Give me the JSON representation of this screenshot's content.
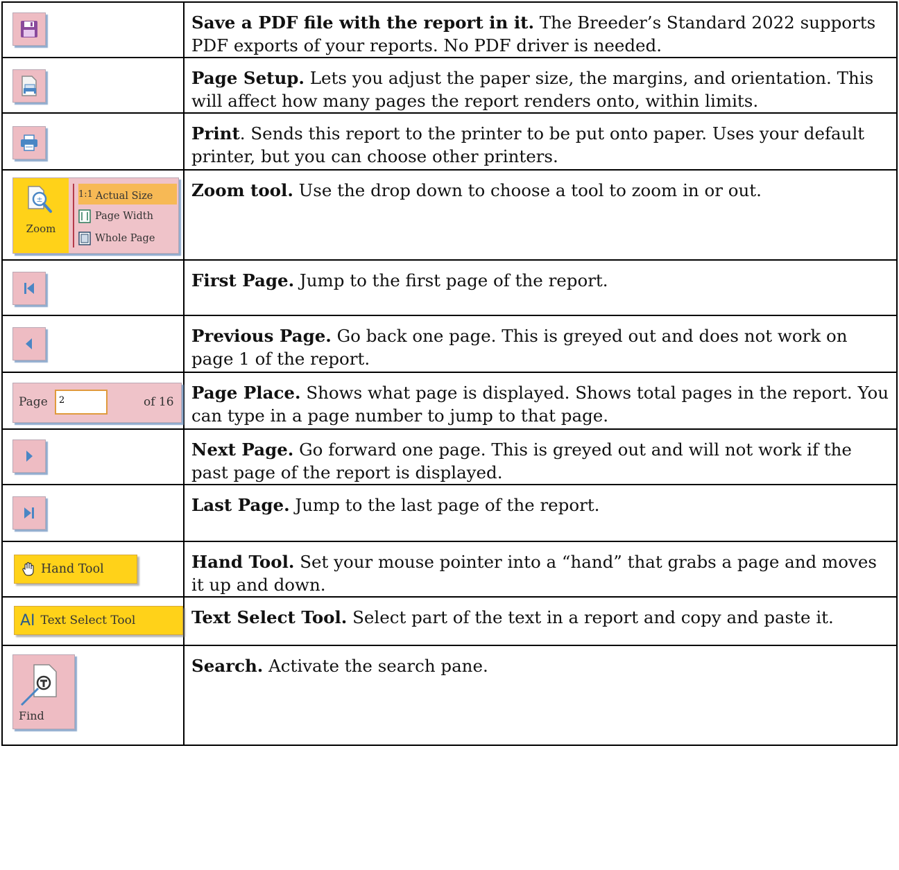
{
  "rows": [
    {
      "title": "Save a PDF file with the report in it.",
      "text": "  The Breeder’s Standard 2022 supports PDF exports of your reports.  No PDF driver is needed.",
      "icon": "save-icon"
    },
    {
      "title": "Page Setup.",
      "text": "  Lets you adjust the paper size, the margins, and orientation.  This will affect how many pages the report renders onto, within limits.",
      "icon": "page-setup-icon"
    },
    {
      "title": "Print",
      "text": ". Sends this report to the printer to be put onto paper.  Uses your default printer, but you can choose other printers.",
      "icon": "print-icon"
    },
    {
      "title": "Zoom tool.",
      "text": "  Use the drop down to choose a tool to zoom in or out.",
      "icon": "zoom-icon"
    },
    {
      "title": "First Page.",
      "text": "  Jump to the first page of the report.",
      "icon": "first-page-icon"
    },
    {
      "title": "Previous Page.",
      "text": "  Go back one page.  This is greyed out and does not work on page 1 of the report.",
      "icon": "previous-page-icon"
    },
    {
      "title": "Page Place.",
      "text": "  Shows what page is displayed.  Shows total pages in the report.  You can type in a page number to jump to that page.",
      "icon": "page-place"
    },
    {
      "title": "Next Page.",
      "text": "  Go forward one page.  This is greyed out and will not work if the past page of the report is displayed.",
      "icon": "next-page-icon"
    },
    {
      "title": "Last Page.",
      "text": "  Jump to the last page of the report.",
      "icon": "last-page-icon"
    },
    {
      "title": "Hand Tool.",
      "text": "  Set your mouse pointer into a “hand” that grabs a page and moves it up and down.",
      "icon": "hand-icon"
    },
    {
      "title": "Text Select Tool.",
      "text": "  Select part of the text in a report and copy and paste it.",
      "icon": "text-select-icon"
    },
    {
      "title": "Search.",
      "text": "  Activate the search pane.",
      "icon": "find-icon"
    }
  ],
  "zoom": {
    "label": "Zoom",
    "options": [
      {
        "prefix": "1:1",
        "label": "Actual Size"
      },
      {
        "label": "Page Width"
      },
      {
        "label": "Whole Page"
      }
    ]
  },
  "page_place": {
    "label": "Page",
    "value": "2",
    "of_label": "of 16"
  },
  "hand_tool": {
    "label": "Hand Tool"
  },
  "text_select_tool": {
    "glyph": "AI",
    "label": "Text Select Tool"
  },
  "find": {
    "label": "Find"
  },
  "colors": {
    "button_bg": "#eebcc3",
    "accent_yellow": "#ffd219",
    "icon_purple": "#8a4a9c",
    "icon_blue": "#4a86c4"
  }
}
